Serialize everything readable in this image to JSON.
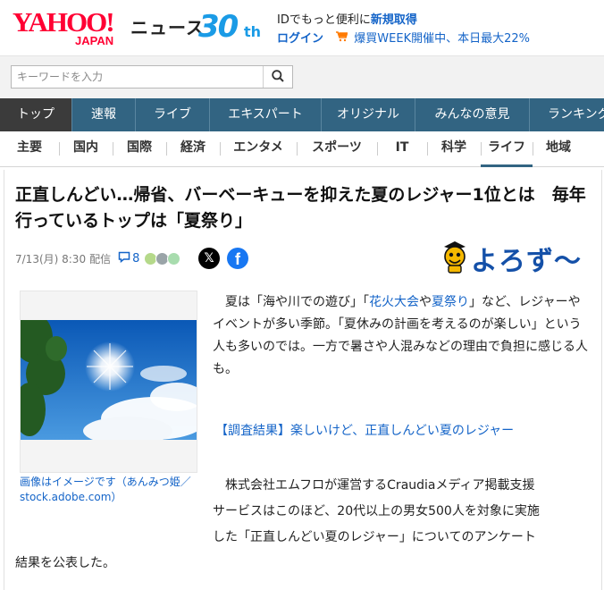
{
  "header": {
    "logo_text": "YAHOO!",
    "logo_sub": "JAPAN",
    "service_name": "ニュース",
    "anniversary_number": "30",
    "anniversary_suffix": "th",
    "promo_text": "IDでもっと便利に",
    "promo_link": "新規取得",
    "login_label": "ログイン",
    "sale_text": "爆買WEEK開催中、本日最大22%"
  },
  "search": {
    "placeholder": "キーワードを入力",
    "value": ""
  },
  "main_nav": {
    "tabs": [
      {
        "label": "トップ"
      },
      {
        "label": "速報"
      },
      {
        "label": "ライブ"
      },
      {
        "label": "エキスパート"
      },
      {
        "label": "オリジナル"
      },
      {
        "label": "みんなの意見"
      },
      {
        "label": "ランキング"
      }
    ],
    "active_index": 0
  },
  "categories": {
    "items": [
      {
        "label": "主要"
      },
      {
        "label": "国内"
      },
      {
        "label": "国際"
      },
      {
        "label": "経済"
      },
      {
        "label": "エンタメ"
      },
      {
        "label": "スポーツ"
      },
      {
        "label": "IT"
      },
      {
        "label": "科学"
      },
      {
        "label": "ライフ"
      },
      {
        "label": "地域"
      }
    ],
    "active_index": 8
  },
  "article": {
    "title": "正直しんどい…帰省、バーベーキューを抑えた夏のレジャー1位とは　毎年行っているトップは「夏祭り」",
    "date": "7/13(月) 8:30",
    "date_suffix": "配信",
    "comment_count": "8",
    "share_x_label": "𝕏",
    "share_fb_label": "f",
    "source_name": "よろず〜",
    "image_caption": "画像はイメージです（あんみつ姫／stock.adobe.com）",
    "p1_a": "夏は「海や川での遊び」「",
    "p1_link1": "花火大会",
    "p1_b": "や",
    "p1_link2": "夏祭り",
    "p1_c": "」など、レジャーやイベントが多い季節。「夏休みの計画を考えるのが楽しい」という人も多いのでは。一方で暑さや人混みなどの理由で負担に感じる人も。",
    "section_link": "【調査結果】楽しいけど、正直しんどい夏のレジャー",
    "p2_line1": "株式会社エムフロが運営するCraudiaメディア掲載支援",
    "p2_line2": "サービスはこのほど、20代以上の男女500人を対象に実施",
    "p2_line3": "した「正直しんどい夏のレジャー」についてのアンケート",
    "p2_line4": "結果を公表した。"
  },
  "colors": {
    "brand_red": "#ff0033",
    "nav_blue": "#326482",
    "nav_active": "#3b3b3b",
    "link_blue": "#1464c8",
    "anniversary_blue": "#1a9be6",
    "source_blue": "#1450a8"
  },
  "icons": {
    "search": "search-icon",
    "cart": "cart-icon",
    "comment": "comment-icon",
    "mascot": "mascot-icon"
  }
}
